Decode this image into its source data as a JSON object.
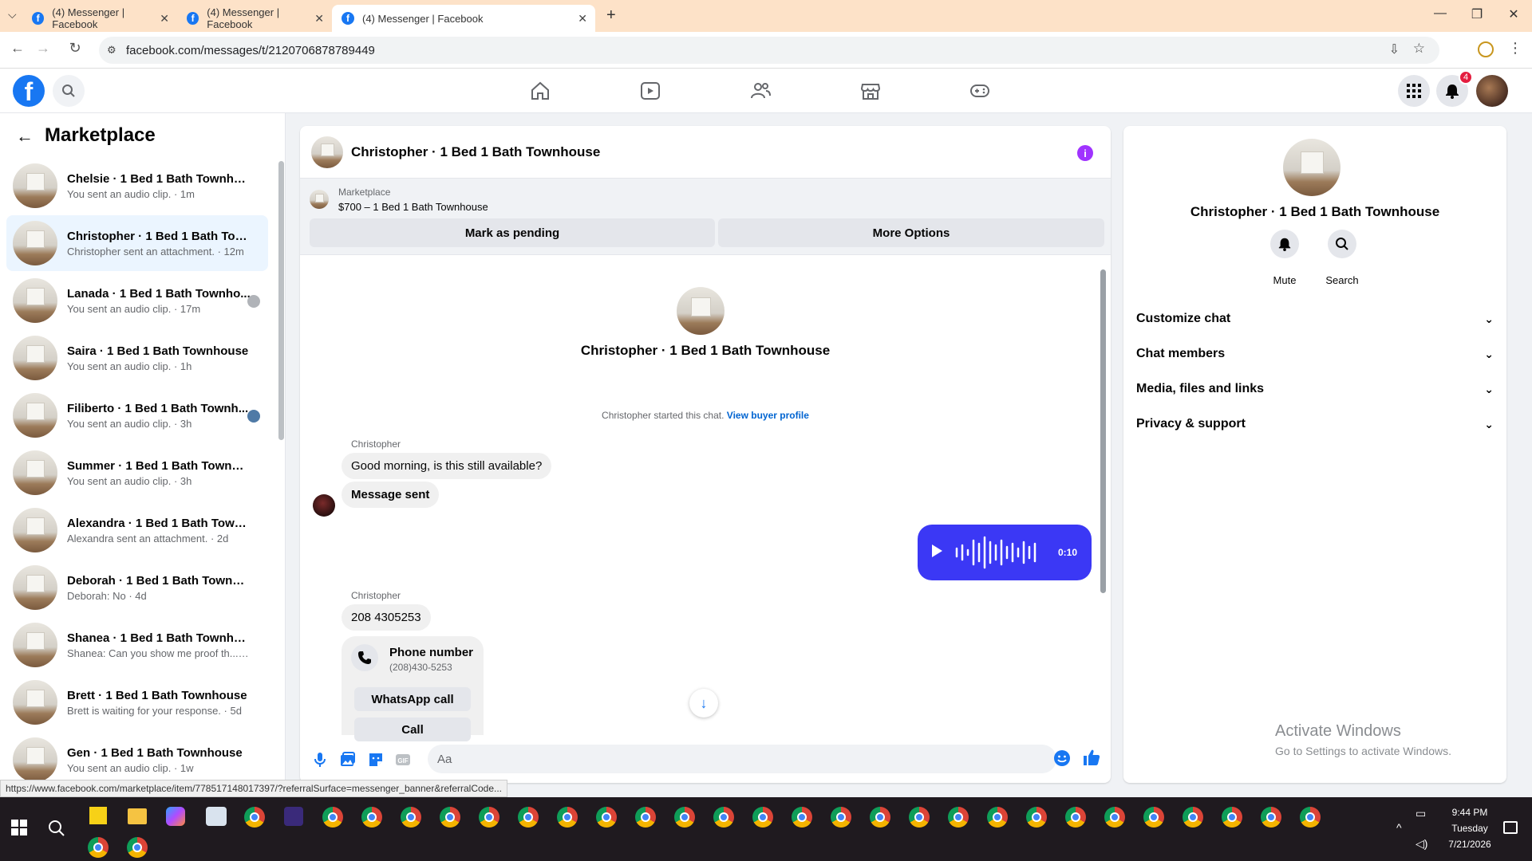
{
  "browser": {
    "tabs": [
      {
        "title": "(4) Messenger | Facebook"
      },
      {
        "title": "(4) Messenger | Facebook"
      },
      {
        "title": "(4) Messenger | Facebook"
      }
    ],
    "url": "facebook.com/messages/t/2120706878789449",
    "status_url": "https://www.facebook.com/marketplace/item/778517148017397/?referralSurface=messenger_banner&referralCode..."
  },
  "header": {
    "notification_count": "4"
  },
  "sidebar": {
    "title": "Marketplace",
    "conversations": [
      {
        "name": "Chelsie · 1 Bed 1 Bath Townhouse",
        "snippet": "You sent an audio clip. · 1m"
      },
      {
        "name": "Christopher · 1 Bed 1 Bath Town...",
        "snippet": "Christopher sent an attachment. · 12m"
      },
      {
        "name": "Lanada · 1 Bed 1 Bath Townho...",
        "snippet": "You sent an audio clip. · 17m"
      },
      {
        "name": "Saira · 1 Bed 1 Bath Townhouse",
        "snippet": "You sent an audio clip. · 1h"
      },
      {
        "name": "Filiberto · 1 Bed 1 Bath Townh...",
        "snippet": "You sent an audio clip. · 3h"
      },
      {
        "name": "Summer · 1 Bed 1 Bath Townhouse",
        "snippet": "You sent an audio clip. · 3h"
      },
      {
        "name": "Alexandra · 1 Bed 1 Bath Townho...",
        "snippet": "Alexandra sent an attachment. · 2d"
      },
      {
        "name": "Deborah · 1 Bed 1 Bath Townhou...",
        "snippet": "Deborah: No · 4d"
      },
      {
        "name": "Shanea · 1 Bed 1 Bath Townhouse",
        "snippet": "Shanea: Can you show me proof th... · 4d"
      },
      {
        "name": "Brett · 1 Bed 1 Bath Townhouse",
        "snippet": "Brett is waiting for your response. · 5d"
      },
      {
        "name": "Gen · 1 Bed 1 Bath Townhouse",
        "snippet": "You sent an audio clip. · 1w"
      }
    ]
  },
  "chat": {
    "title": "Christopher · 1 Bed 1 Bath Townhouse",
    "banner": {
      "label": "Marketplace",
      "listing": "$700 – 1 Bed 1 Bath Townhouse",
      "pending_button": "Mark as pending",
      "options_button": "More Options"
    },
    "intro_name": "Christopher · 1 Bed 1 Bath Townhouse",
    "started_text": "Christopher started this chat.",
    "view_profile": "View buyer profile",
    "sender1": "Christopher",
    "msg1": "Good morning, is this still available?",
    "msg2": "Message sent",
    "audio_duration": "0:10",
    "sender2": "Christopher",
    "msg3": "208 4305253",
    "phone_card": {
      "title": "Phone number",
      "number": "(208)430-5253",
      "whatsapp": "WhatsApp call",
      "call": "Call"
    },
    "composer_placeholder": "Aa"
  },
  "info_panel": {
    "name": "Christopher · 1 Bed 1 Bath Townhouse",
    "mute": "Mute",
    "search": "Search",
    "sections": [
      "Customize chat",
      "Chat members",
      "Media, files and links",
      "Privacy & support"
    ]
  },
  "watermark": {
    "title": "Activate Windows",
    "subtitle": "Go to Settings to activate Windows."
  },
  "taskbar": {
    "time": "9:44 PM",
    "day": "Tuesday",
    "date": "7/21/2026"
  },
  "colors": {
    "accent": "#1877f2",
    "audio_bubble": "#3b38f5",
    "info_icon": "#a033ff",
    "tab_strip": "#fde2c8"
  }
}
